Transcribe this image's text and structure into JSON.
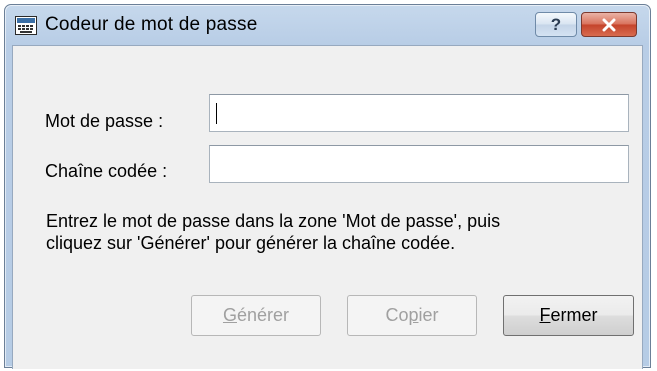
{
  "window": {
    "title": "Codeur de mot de passe",
    "icon": "keyboard-app-icon",
    "help_label": "?",
    "close_label": "x"
  },
  "form": {
    "password_label": "Mot de passe :",
    "password_value": "",
    "encoded_label": "Chaîne codée :",
    "encoded_value": ""
  },
  "message": {
    "line1": "Entrez le mot de passe dans la zone 'Mot de passe', puis",
    "line2": "cliquez sur 'Générer' pour générer la chaîne codée."
  },
  "buttons": {
    "generate": {
      "accel": "G",
      "rest": "énérer",
      "enabled": false
    },
    "copy": {
      "before": "Co",
      "accel": "p",
      "after": "ier",
      "enabled": false
    },
    "close": {
      "accel": "F",
      "rest": "ermer",
      "enabled": true
    }
  },
  "colors": {
    "titlebar": "#b8cde6",
    "client": "#f0f0f0",
    "close_button": "#c4432b"
  }
}
